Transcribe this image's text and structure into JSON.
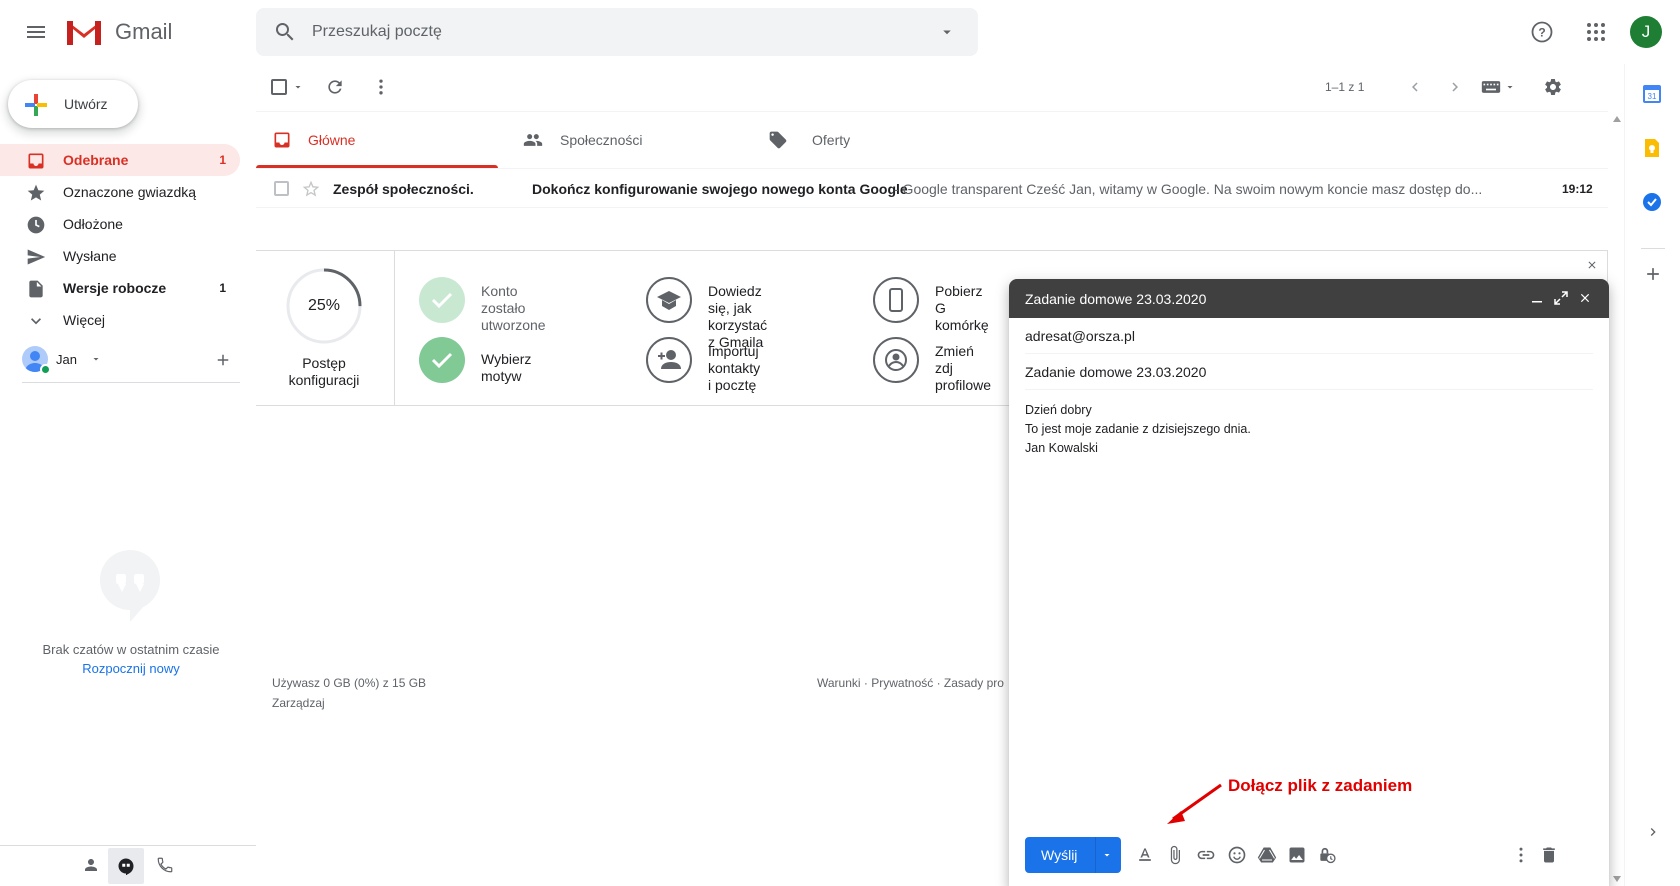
{
  "header": {
    "app_name": "Gmail",
    "search_placeholder": "Przeszukaj pocztę",
    "avatar_letter": "J"
  },
  "sidebar": {
    "compose_label": "Utwórz",
    "items": [
      {
        "label": "Odebrane",
        "count": "1"
      },
      {
        "label": "Oznaczone gwiazdką",
        "count": ""
      },
      {
        "label": "Odłożone",
        "count": ""
      },
      {
        "label": "Wysłane",
        "count": ""
      },
      {
        "label": "Wersje robocze",
        "count": "1"
      },
      {
        "label": "Więcej",
        "count": ""
      }
    ],
    "hangouts_user": "Jan",
    "chat_empty_text": "Brak czatów w ostatnim czasie",
    "chat_start_link": "Rozpocznij nowy"
  },
  "toolbar": {
    "pagination": "1–1 z 1"
  },
  "tabs": [
    {
      "label": "Główne"
    },
    {
      "label": "Społeczności"
    },
    {
      "label": "Oferty"
    }
  ],
  "email": {
    "sender": "Zespół społeczności.",
    "subject": "Dokończ konfigurowanie swojego nowego konta Google",
    "snippet": " - Google transparent Cześć Jan, witamy w Google. Na swoim nowym koncie masz dostęp do...",
    "time": "19:12"
  },
  "setup": {
    "progress_label": "25%",
    "progress_value": 0.25,
    "progress_caption_1": "Postęp",
    "progress_caption_2": "konfiguracji",
    "items": [
      {
        "line1": "Konto zostało",
        "line2": "utworzone"
      },
      {
        "line1": "Wybierz motyw",
        "line2": ""
      },
      {
        "line1": "Dowiedz się, jak",
        "line2": "korzystać z Gmaila"
      },
      {
        "line1": "Importuj kontakty",
        "line2": "i pocztę"
      },
      {
        "line1": "Pobierz G",
        "line2": "komórkę"
      },
      {
        "line1": "Zmień zdj",
        "line2": "profilowe"
      }
    ]
  },
  "footer": {
    "storage": "Używasz 0 GB (0%) z 15 GB",
    "manage": "Zarządzaj",
    "links": "Warunki · Prywatność · Zasady pro"
  },
  "compose": {
    "title": "Zadanie domowe 23.03.2020",
    "to": "adresat@orsza.pl",
    "subject": "Zadanie domowe 23.03.2020",
    "body_line1": "Dzień dobry",
    "body_line2": "To jest moje zadanie z dzisiejszego dnia.",
    "body_line3": "Jan Kowalski",
    "send_label": "Wyślij"
  },
  "annotation": {
    "text": "Dołącz plik z zadaniem",
    "color": "#e00000"
  },
  "colors": {
    "accent_red": "#d93025",
    "blue": "#1a73e8",
    "setup_green": "#81c995"
  }
}
